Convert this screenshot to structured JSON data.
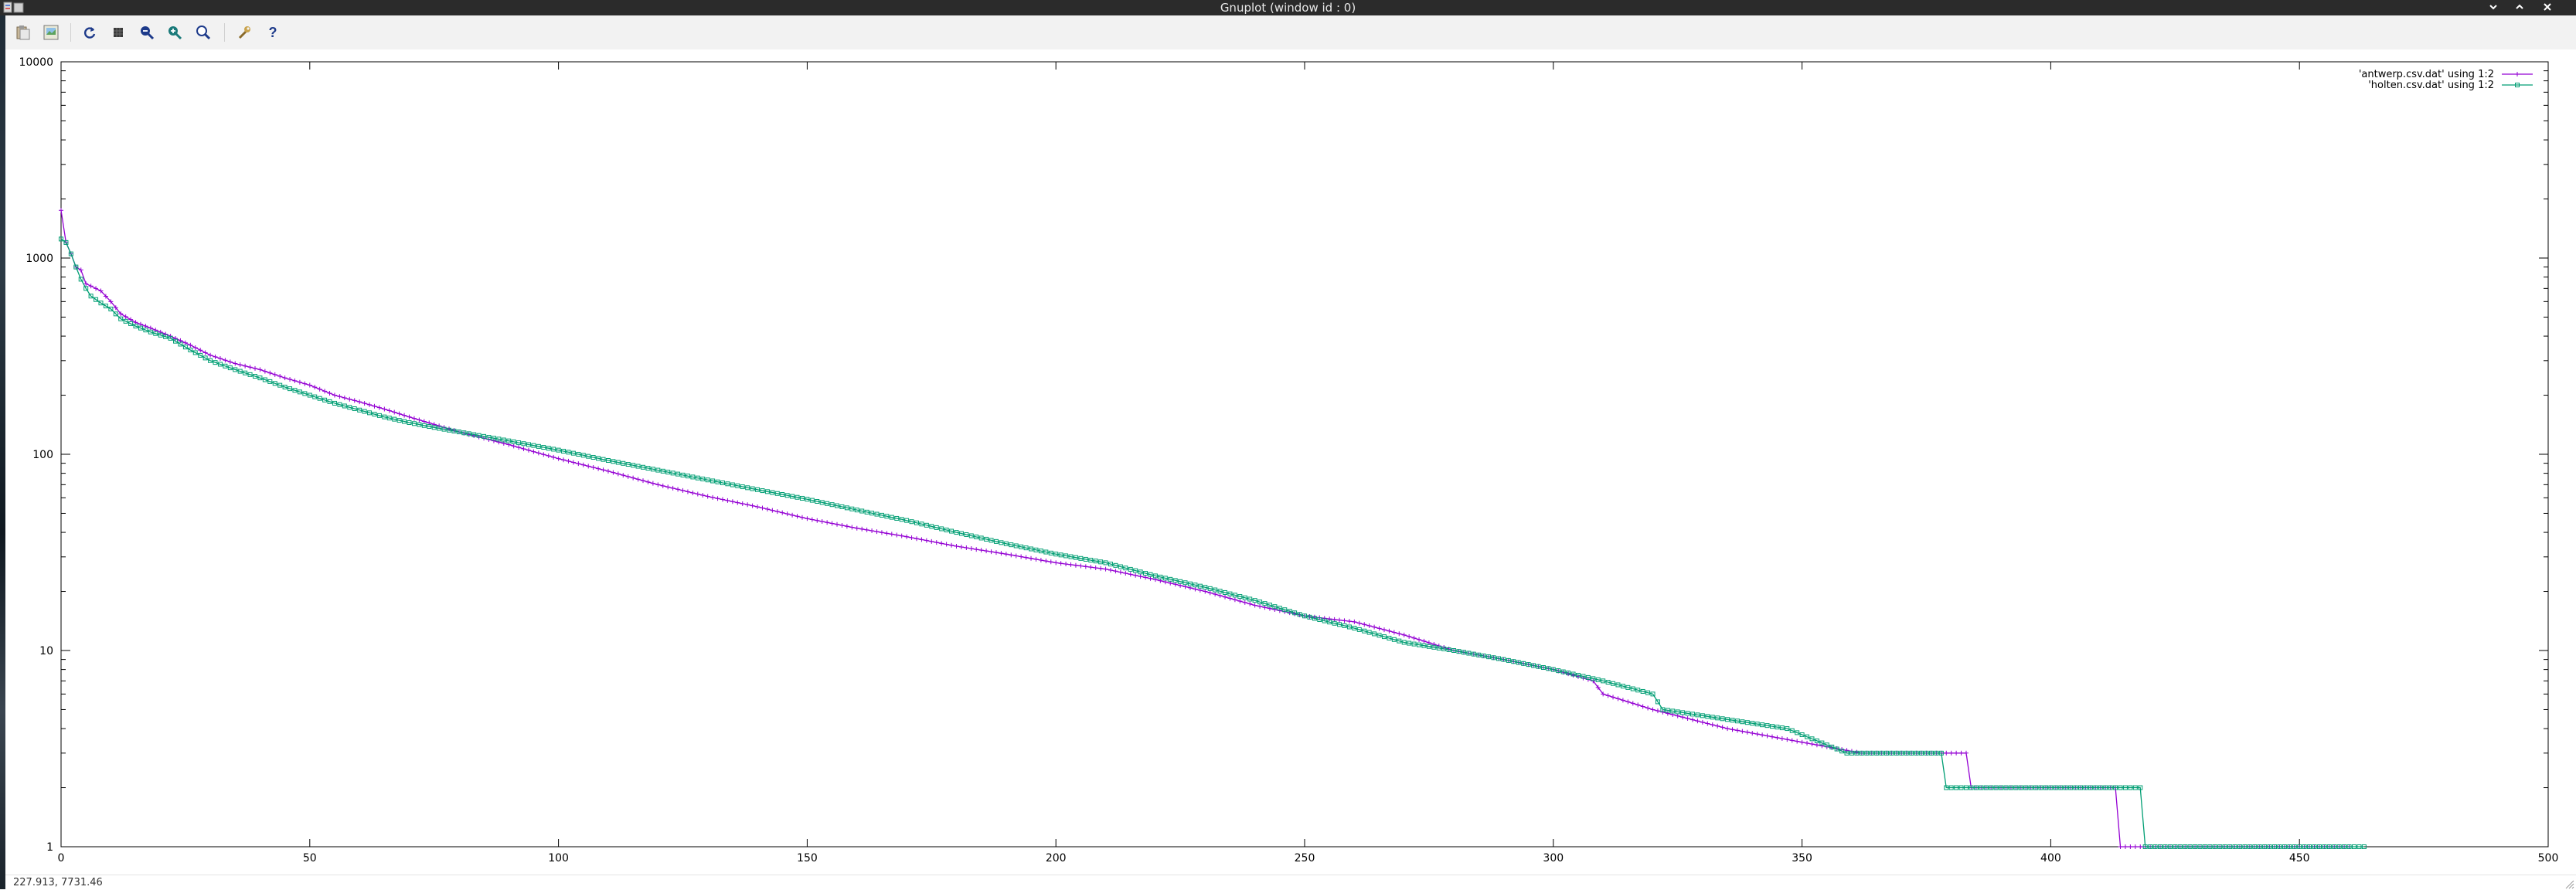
{
  "window": {
    "title": "Gnuplot (window id : 0)",
    "controls": [
      "minimize",
      "maximize",
      "close"
    ]
  },
  "toolbar": {
    "buttons": [
      {
        "name": "copy-to-clipboard",
        "icon": "clipboard-icon"
      },
      {
        "name": "print",
        "icon": "print-icon"
      },
      {
        "name": "replot",
        "icon": "refresh-icon"
      },
      {
        "name": "toggle-grid",
        "icon": "grid-icon"
      },
      {
        "name": "previous-zoom",
        "icon": "zoom-prev-icon"
      },
      {
        "name": "next-zoom",
        "icon": "zoom-next-icon"
      },
      {
        "name": "autoscale",
        "icon": "zoom-auto-icon"
      },
      {
        "name": "options",
        "icon": "wrench-icon"
      },
      {
        "name": "help",
        "icon": "help-icon"
      }
    ]
  },
  "status": {
    "coords": "227.913,  7731.46"
  },
  "colors": {
    "series1": "#9400d3",
    "series2": "#009e73"
  },
  "chart_data": {
    "type": "line",
    "title": "",
    "xlabel": "",
    "ylabel": "",
    "xlim": [
      0,
      500
    ],
    "ylim": [
      1,
      10000
    ],
    "yscale": "log",
    "grid": false,
    "legend": "top-right",
    "xticks": [
      "0",
      "50",
      "100",
      "150",
      "200",
      "250",
      "300",
      "350",
      "400",
      "450",
      "500"
    ],
    "yticks": [
      "1",
      "10",
      "100",
      "1000",
      "10000"
    ],
    "series": [
      {
        "name": "'antwerp.csv.dat' using 1:2",
        "marker": "plus",
        "points": [
          [
            0,
            1750
          ],
          [
            1,
            1200
          ],
          [
            2,
            1050
          ],
          [
            3,
            900
          ],
          [
            4,
            870
          ],
          [
            5,
            740
          ],
          [
            6,
            720
          ],
          [
            8,
            680
          ],
          [
            10,
            600
          ],
          [
            12,
            520
          ],
          [
            15,
            470
          ],
          [
            18,
            440
          ],
          [
            22,
            400
          ],
          [
            26,
            360
          ],
          [
            30,
            320
          ],
          [
            35,
            290
          ],
          [
            40,
            270
          ],
          [
            45,
            245
          ],
          [
            50,
            225
          ],
          [
            55,
            200
          ],
          [
            60,
            185
          ],
          [
            65,
            170
          ],
          [
            70,
            155
          ],
          [
            75,
            142
          ],
          [
            80,
            130
          ],
          [
            90,
            112
          ],
          [
            100,
            95
          ],
          [
            110,
            82
          ],
          [
            120,
            70
          ],
          [
            130,
            61
          ],
          [
            140,
            54
          ],
          [
            150,
            47
          ],
          [
            160,
            42
          ],
          [
            170,
            38
          ],
          [
            180,
            34
          ],
          [
            190,
            31
          ],
          [
            200,
            28
          ],
          [
            210,
            26
          ],
          [
            220,
            23
          ],
          [
            230,
            20
          ],
          [
            240,
            17
          ],
          [
            250,
            15
          ],
          [
            260,
            14
          ],
          [
            270,
            12
          ],
          [
            280,
            10
          ],
          [
            290,
            9
          ],
          [
            300,
            8
          ],
          [
            308,
            7
          ],
          [
            310,
            6
          ],
          [
            320,
            5
          ],
          [
            335,
            4
          ],
          [
            362,
            3
          ],
          [
            384,
            2
          ],
          [
            414,
            1
          ],
          [
            460,
            1
          ]
        ]
      },
      {
        "name": "'holten.csv.dat' using 1:2",
        "marker": "box",
        "points": [
          [
            0,
            1250
          ],
          [
            1,
            1200
          ],
          [
            2,
            1050
          ],
          [
            3,
            900
          ],
          [
            4,
            780
          ],
          [
            5,
            700
          ],
          [
            6,
            640
          ],
          [
            8,
            590
          ],
          [
            10,
            550
          ],
          [
            12,
            490
          ],
          [
            15,
            450
          ],
          [
            18,
            420
          ],
          [
            22,
            390
          ],
          [
            26,
            340
          ],
          [
            30,
            300
          ],
          [
            35,
            270
          ],
          [
            40,
            245
          ],
          [
            45,
            220
          ],
          [
            50,
            200
          ],
          [
            55,
            182
          ],
          [
            60,
            168
          ],
          [
            65,
            155
          ],
          [
            70,
            145
          ],
          [
            75,
            137
          ],
          [
            80,
            130
          ],
          [
            90,
            117
          ],
          [
            100,
            105
          ],
          [
            110,
            93
          ],
          [
            120,
            83
          ],
          [
            130,
            74
          ],
          [
            140,
            66
          ],
          [
            150,
            59
          ],
          [
            160,
            52
          ],
          [
            170,
            46
          ],
          [
            180,
            40
          ],
          [
            190,
            35
          ],
          [
            200,
            31
          ],
          [
            210,
            28
          ],
          [
            220,
            24
          ],
          [
            230,
            21
          ],
          [
            240,
            18
          ],
          [
            250,
            15
          ],
          [
            260,
            13
          ],
          [
            270,
            11
          ],
          [
            280,
            10
          ],
          [
            290,
            9
          ],
          [
            300,
            8
          ],
          [
            310,
            7
          ],
          [
            320,
            6
          ],
          [
            322,
            5
          ],
          [
            347,
            4
          ],
          [
            359,
            3
          ],
          [
            379,
            2
          ],
          [
            419,
            1
          ],
          [
            463,
            1
          ]
        ]
      }
    ]
  }
}
